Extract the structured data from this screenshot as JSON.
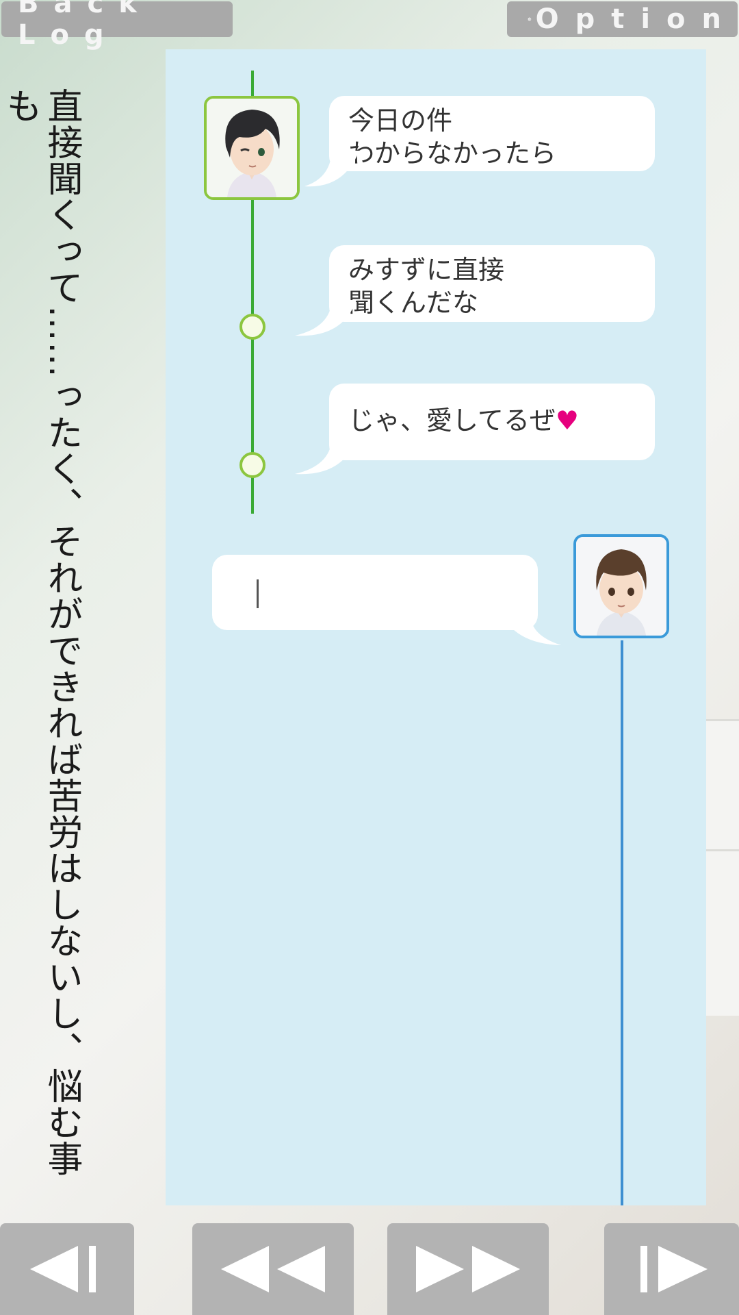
{
  "header": {
    "backlog_label": "Back Log",
    "option_label": "Option"
  },
  "narration": {
    "text": "直接聞くって……ったく、それができれば苦労はしないし、悩む事も"
  },
  "messages": [
    {
      "lines": [
        "今日の件",
        "わからなかったら"
      ],
      "speaker": "left"
    },
    {
      "lines": [
        "みすずに直接",
        "聞くんだな"
      ],
      "speaker": "left"
    },
    {
      "lines": [
        "じゃ、愛してるぜ"
      ],
      "suffix": "♥",
      "speaker": "left"
    }
  ],
  "reply": {
    "value": ""
  },
  "colors": {
    "panel": "#d6edf5",
    "left_line": "#3aaa35",
    "right_line": "#3d8fd1",
    "heart": "#e6007e",
    "buttons": "#b3b3b3"
  },
  "icons": {
    "option": "gear-icon",
    "nav": [
      "skip-back-icon",
      "rewind-icon",
      "fast-forward-icon",
      "skip-forward-icon"
    ]
  }
}
